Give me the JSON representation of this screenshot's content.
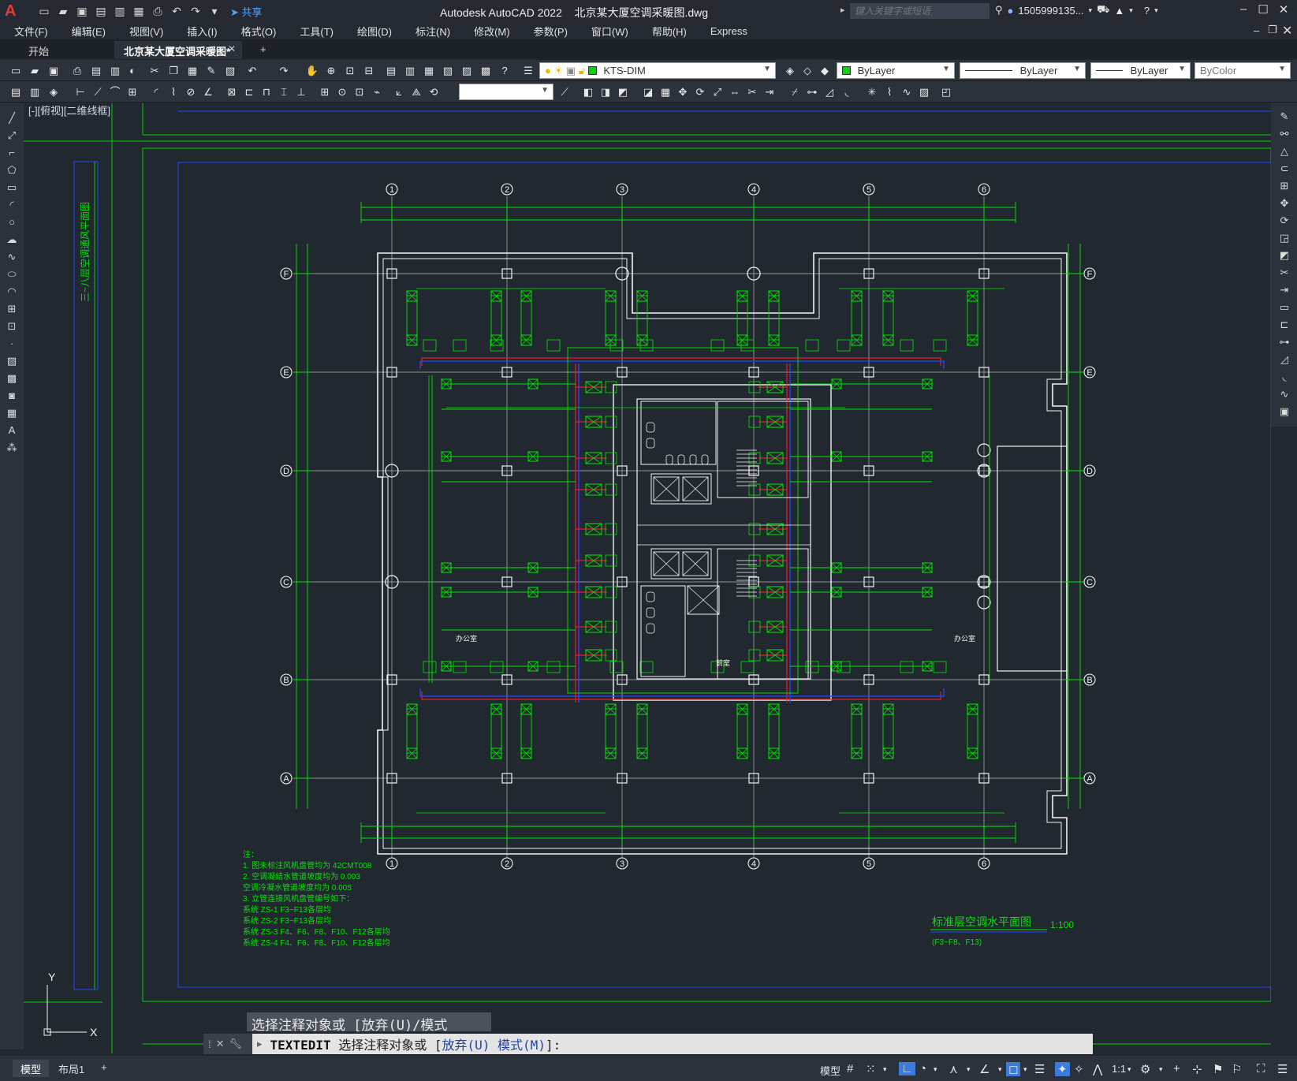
{
  "app": {
    "title": "Autodesk AutoCAD 2022    北京某大厦空调采暖图.dwg",
    "share": "共享",
    "search_placeholder": "键入关键字或短语",
    "user": "1505999135...",
    "logo": "A"
  },
  "menu": [
    "文件(F)",
    "编辑(E)",
    "视图(V)",
    "插入(I)",
    "格式(O)",
    "工具(T)",
    "绘图(D)",
    "标注(N)",
    "修改(M)",
    "参数(P)",
    "窗口(W)",
    "帮助(H)",
    "Express"
  ],
  "tabs": {
    "start": "开始",
    "doc": "北京某大厦空调采暖图*",
    "close": "✕",
    "add": "+"
  },
  "toolbar": {
    "layer": "KTS-DIM",
    "color": "ByLayer",
    "linetype": "ByLayer",
    "lineweight": "ByLayer",
    "plotstyle": "ByColor"
  },
  "viewport": {
    "label": "[-][俯视][二维线框]"
  },
  "drawing": {
    "axis_numbers": [
      "1",
      "2",
      "3",
      "4",
      "5",
      "6"
    ],
    "axis_letters": [
      "A",
      "B",
      "C",
      "D",
      "E",
      "F"
    ],
    "side_title": "三~八层空调通风平面图",
    "room_left": "办公室",
    "room_right": "办公室",
    "hall": "前室",
    "notes": [
      "注：",
      "1. 图未标注风机盘管均为 42CMT008",
      "2. 空调凝结水管道坡度均为 0.003",
      "空调冷凝水管道坡度均为 0.005",
      "3. 立管连接风机盘管编号如下：",
      "系统 ZS-1 F3~F13各层均",
      "系统 ZS-2 F3~F13各层均",
      "系统 ZS-3 F4、F6、F8、F10、F12各层均",
      "系统 ZS-4 F4、F6、F8、F10、F12各层均"
    ],
    "plan_title": "标准层空调水平面图",
    "plan_scale": "1:100",
    "plan_floors": "(F3~F8、F13)",
    "ucs_x": "X",
    "ucs_y": "Y"
  },
  "command": {
    "history": "选择注释对象或 [放弃(U)/模式(M)]:",
    "cmd": "TEXTEDIT",
    "prompt_pre": " 选择注释对象或 [",
    "opt1": "放弃(U)",
    "opt2": "模式(M)",
    "prompt_post": "]:"
  },
  "status": {
    "tab_model": "模型",
    "tab_layout": "布局1",
    "add": "+",
    "model_label": "模型",
    "scale": "1:1"
  },
  "colors": {
    "bg": "#212830",
    "green": "#00e600",
    "blue": "#2c46ff",
    "red": "#e8192c",
    "white": "#f2f2f2",
    "grid": "#b6b6b6"
  }
}
